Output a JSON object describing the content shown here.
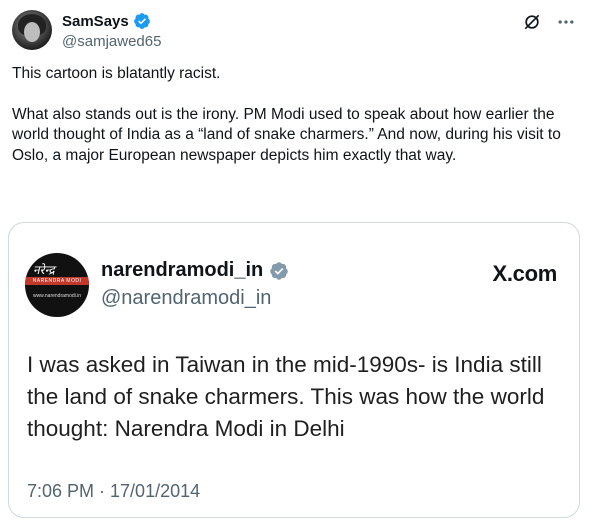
{
  "post": {
    "author": {
      "display_name": "SamSays",
      "handle": "@samjawed65",
      "verified": true
    },
    "actions": {
      "grok_icon": "slash-circle-icon",
      "more_icon": "more-icon"
    },
    "text": {
      "paragraph_1": "This cartoon is blatantly racist.",
      "paragraph_2": "What also stands out is the irony. PM Modi used to speak about how earlier the world thought of India as a “land of snake charmers.” And now, during his visit to Oslo, a major European newspaper depicts him exactly that way."
    }
  },
  "embedded_tweet": {
    "author": {
      "display_name": "narendramodi_in",
      "handle": "@narendramodi_in",
      "verified": true
    },
    "source": "X.com",
    "body": "I was asked in Taiwan in the mid-1990s- is India still the land of snake charmers. This was how the world thought: Narendra Modi in Delhi",
    "timestamp": "7:06 PM · 17/01/2014"
  },
  "colors": {
    "text_primary": "#0f1419",
    "text_secondary": "#536471",
    "verified_blue": "#1d9bf0",
    "card_border": "#cfd9de"
  }
}
